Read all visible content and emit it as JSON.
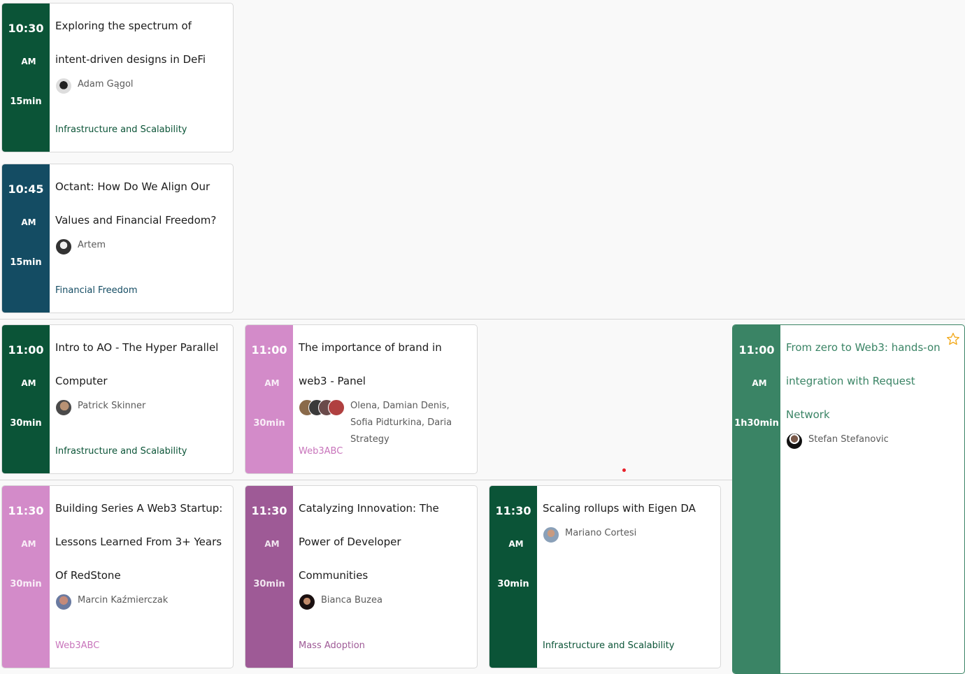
{
  "sessions": [
    {
      "time": "10:30",
      "ampm": "AM",
      "duration": "15min",
      "title": "Exploring the spectrum of intent-driven designs in DeFi",
      "speakers": "Adam Gągol",
      "track": "Infrastructure and Scalability",
      "color": "#0b5437",
      "track_color": "#0b5437"
    },
    {
      "time": "10:45",
      "ampm": "AM",
      "duration": "15min",
      "title": "Octant: How Do We Align Our Values and Financial Freedom?",
      "speakers": "Artem",
      "track": "Financial Freedom",
      "color": "#144c63",
      "track_color": "#144c63"
    },
    {
      "time": "11:00",
      "ampm": "AM",
      "duration": "30min",
      "title": "Intro to AO - The Hyper Parallel Computer",
      "speakers": "Patrick Skinner",
      "track": "Infrastructure and Scalability",
      "color": "#0b5437",
      "track_color": "#0b5437"
    },
    {
      "time": "11:00",
      "ampm": "AM",
      "duration": "30min",
      "title": "The importance of brand in web3 - Panel",
      "speakers": "Olena, Damian Denis, Sofia Pidturkina, Daria Strategy",
      "track": "Web3ABC",
      "color": "#d38bc9",
      "track_color": "#c874bb"
    },
    {
      "time": "11:00",
      "ampm": "AM",
      "duration": "1h30min",
      "title": "From zero to Web3: hands-on integration with Request Network",
      "speakers": "Stefan Stefanovic",
      "track": "",
      "color": "#3a8465",
      "track_color": "#3a8465",
      "favorite_icon": "star-outline-icon",
      "favorite_color": "#f2a818"
    },
    {
      "time": "11:30",
      "ampm": "AM",
      "duration": "30min",
      "title": "Building Series A Web3 Startup: Lessons Learned From 3+ Years Of RedStone",
      "speakers": "Marcin Kaźmierczak",
      "track": "Web3ABC",
      "color": "#d38bc9",
      "track_color": "#c874bb"
    },
    {
      "time": "11:30",
      "ampm": "AM",
      "duration": "30min",
      "title": "Catalyzing Innovation: The Power of Developer Communities",
      "speakers": "Bianca Buzea",
      "track": "Mass Adoption",
      "color": "#9e5a96",
      "track_color": "#9e5a96"
    },
    {
      "time": "11:30",
      "ampm": "AM",
      "duration": "30min",
      "title": "Scaling rollups with Eigen DA",
      "speakers": "Mariano Cortesi",
      "track": "Infrastructure and Scalability",
      "color": "#0b5437",
      "track_color": "#0b5437"
    }
  ]
}
